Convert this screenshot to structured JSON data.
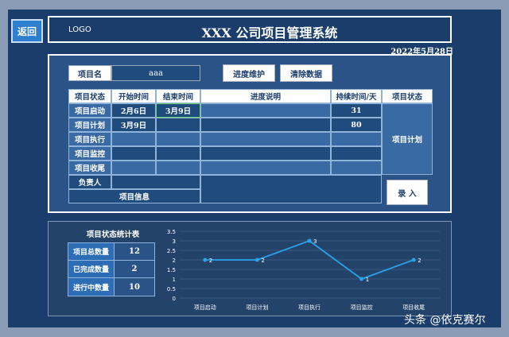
{
  "header": {
    "back_label": "返回",
    "logo": "LOGO",
    "title": "XXX 公司项目管理系统",
    "date": "2022年5月28日"
  },
  "project": {
    "name_label": "项目名",
    "name_value": "aaa",
    "maintain_label": "进度维护",
    "clear_label": "清除数据",
    "enter_label": "录 入"
  },
  "table": {
    "headers": [
      "项目状态",
      "开始时间",
      "结束时间",
      "进度说明",
      "持续时间/天",
      "项目状态"
    ],
    "rows": [
      {
        "stage": "项目启动",
        "start": "2月6日",
        "end": "3月9日",
        "note": "",
        "duration": "31"
      },
      {
        "stage": "项目计划",
        "start": "3月9日",
        "end": "",
        "note": "",
        "duration": "80"
      },
      {
        "stage": "项目执行",
        "start": "",
        "end": "",
        "note": "",
        "duration": ""
      },
      {
        "stage": "项目监控",
        "start": "",
        "end": "",
        "note": "",
        "duration": ""
      },
      {
        "stage": "项目收尾",
        "start": "",
        "end": "",
        "note": "",
        "duration": ""
      }
    ],
    "owner_label": "负责人",
    "info_label": "项目信息",
    "current_status": "项目计划"
  },
  "stats": {
    "title": "项目状态统计表",
    "items": [
      {
        "label": "项目总数量",
        "value": "12"
      },
      {
        "label": "已完成数量",
        "value": "2"
      },
      {
        "label": "进行中数量",
        "value": "10"
      }
    ]
  },
  "chart_data": {
    "type": "line",
    "categories": [
      "项目启动",
      "项目计划",
      "项目执行",
      "项目监控",
      "项目收尾"
    ],
    "values": [
      2,
      2,
      3,
      1,
      2
    ],
    "ylim": [
      0,
      3.5
    ],
    "yticks": [
      "0",
      "0.5",
      "1",
      "1.5",
      "2",
      "2.5",
      "3",
      "3.5"
    ],
    "grid": true,
    "color": "#29a3e8"
  },
  "watermark": "头条 @依克赛尔"
}
